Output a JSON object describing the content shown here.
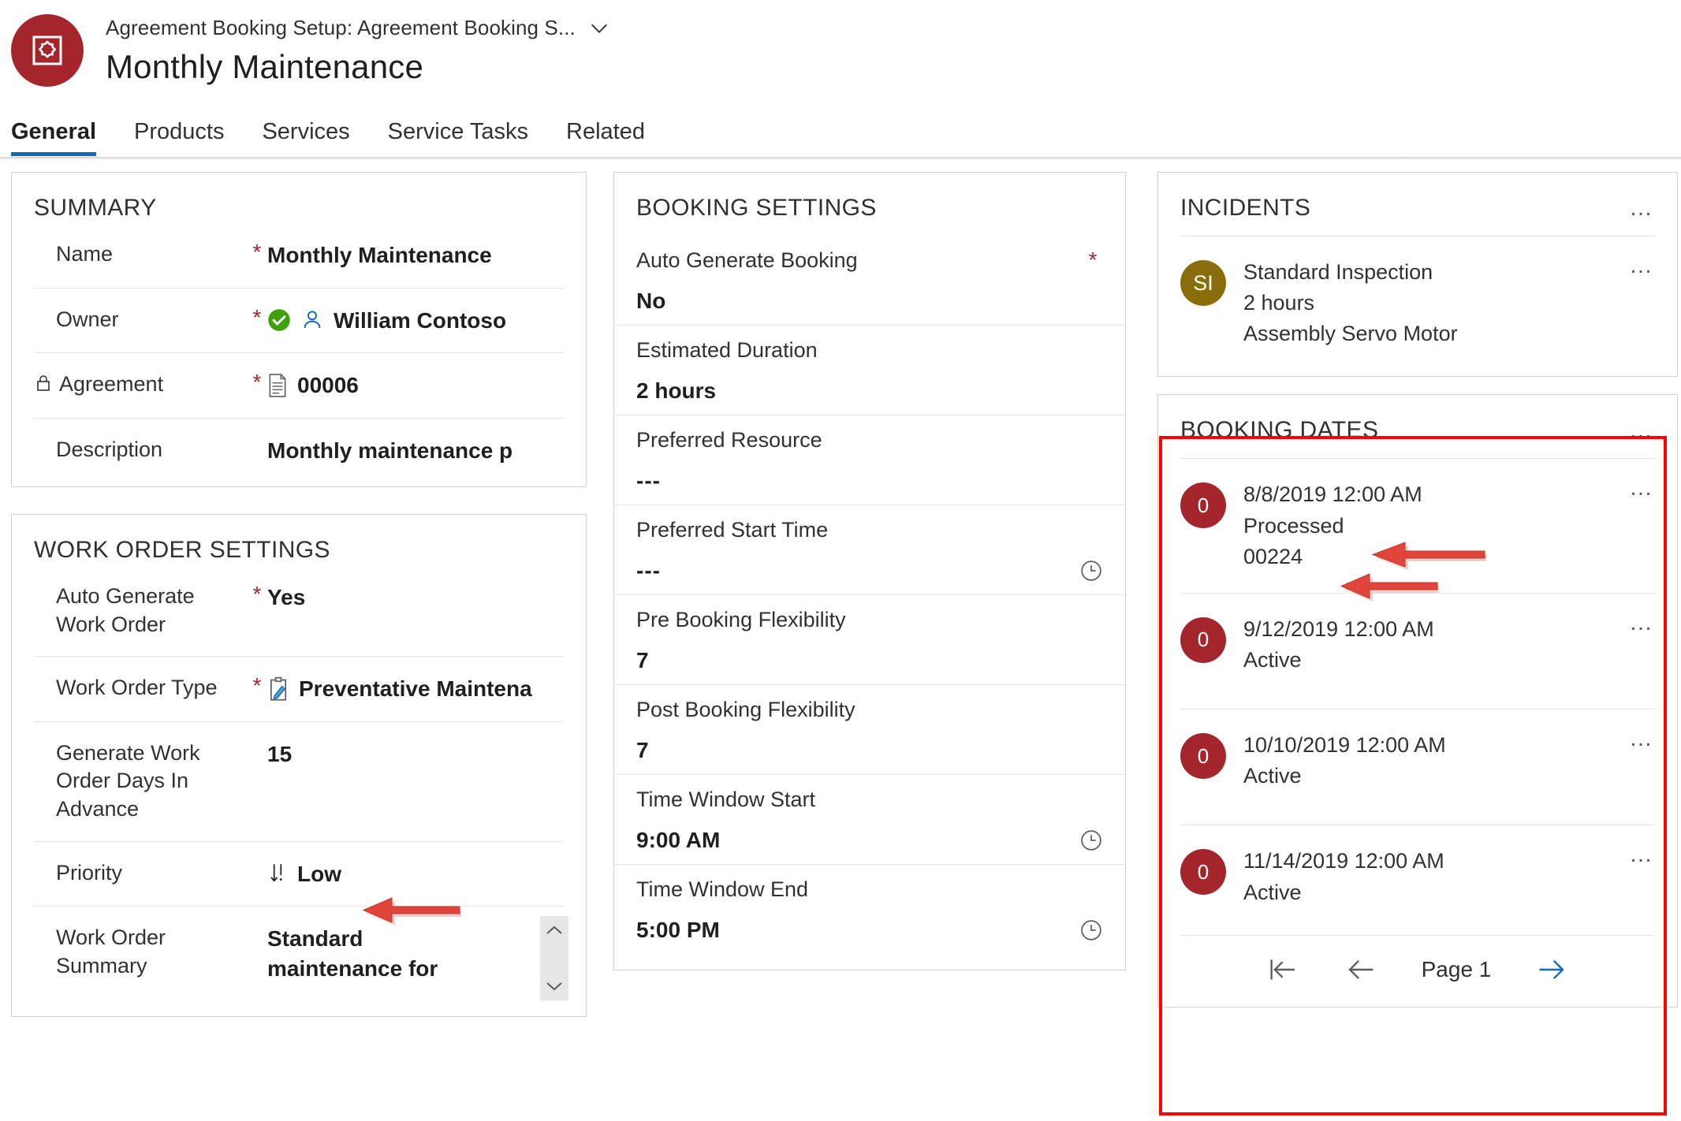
{
  "header": {
    "breadcrumb": "Agreement Booking Setup: Agreement Booking S...",
    "record_title": "Monthly Maintenance",
    "entity_icon": "agreement-booking-setup-icon",
    "avatar_color": "#a4262c"
  },
  "tabs": [
    {
      "label": "General",
      "active": true
    },
    {
      "label": "Products",
      "active": false
    },
    {
      "label": "Services",
      "active": false
    },
    {
      "label": "Service Tasks",
      "active": false
    },
    {
      "label": "Related",
      "active": false
    }
  ],
  "summary": {
    "title": "SUMMARY",
    "fields": [
      {
        "label": "Name",
        "required": true,
        "value": "Monthly Maintenance",
        "locked": false,
        "link": false
      },
      {
        "label": "Owner",
        "required": true,
        "value": "William Contoso",
        "locked": false,
        "link": true,
        "icons": [
          "status-ok-icon",
          "person-icon"
        ]
      },
      {
        "label": "Agreement",
        "required": true,
        "value": "00006",
        "locked": true,
        "link": true,
        "icons": [
          "document-icon"
        ]
      },
      {
        "label": "Description",
        "required": false,
        "value": "Monthly maintenance p",
        "locked": false,
        "link": false
      }
    ]
  },
  "work_order_settings": {
    "title": "WORK ORDER SETTINGS",
    "fields": [
      {
        "label": "Auto Generate Work Order",
        "required": true,
        "value": "Yes",
        "link": false
      },
      {
        "label": "Work Order Type",
        "required": true,
        "value": "Preventative Maintena",
        "link": true,
        "icons": [
          "clipboard-edit-icon"
        ]
      },
      {
        "label": "Generate Work Order Days In Advance",
        "required": false,
        "value": "15",
        "link": false,
        "annotated": true
      },
      {
        "label": "Priority",
        "required": false,
        "value": "Low",
        "link": true,
        "icons": [
          "priority-low-icon"
        ]
      },
      {
        "label": "Work Order Summary",
        "required": false,
        "value": "Standard maintenance for",
        "link": false,
        "scrollable": true
      }
    ]
  },
  "booking_settings": {
    "title": "BOOKING SETTINGS",
    "fields": [
      {
        "label": "Auto Generate Booking",
        "required": true,
        "value": "No",
        "icon": ""
      },
      {
        "label": "Estimated Duration",
        "required": false,
        "value": "2 hours",
        "icon": ""
      },
      {
        "label": "Preferred Resource",
        "required": false,
        "value": "---",
        "icon": ""
      },
      {
        "label": "Preferred Start Time",
        "required": false,
        "value": "---",
        "icon": "clock-icon"
      },
      {
        "label": "Pre Booking Flexibility",
        "required": false,
        "value": "7",
        "icon": ""
      },
      {
        "label": "Post Booking Flexibility",
        "required": false,
        "value": "7",
        "icon": ""
      },
      {
        "label": "Time Window Start",
        "required": false,
        "value": "9:00 AM",
        "icon": "clock-icon"
      },
      {
        "label": "Time Window End",
        "required": false,
        "value": "5:00 PM",
        "icon": "clock-icon"
      }
    ]
  },
  "incidents": {
    "title": "INCIDENTS",
    "menu": "…",
    "items": [
      {
        "initials": "SI",
        "bubble_color": "#8a6d0b",
        "line1": "Standard Inspection",
        "line2": "2 hours",
        "line3": "Assembly Servo Motor"
      }
    ]
  },
  "booking_dates": {
    "title": "BOOKING DATES",
    "menu": "…",
    "highlighted": true,
    "items": [
      {
        "count": "0",
        "bubble_color": "#a4262c",
        "line1": "8/8/2019 12:00 AM",
        "line2": "Processed",
        "line3": "00224",
        "annotated": true
      },
      {
        "count": "0",
        "bubble_color": "#a4262c",
        "line1": "9/12/2019 12:00 AM",
        "line2": "Active",
        "line3": "",
        "annotated": false
      },
      {
        "count": "0",
        "bubble_color": "#a4262c",
        "line1": "10/10/2019 12:00 AM",
        "line2": "Active",
        "line3": "",
        "annotated": false
      },
      {
        "count": "0",
        "bubble_color": "#a4262c",
        "line1": "11/14/2019 12:00 AM",
        "line2": "Active",
        "line3": "",
        "annotated": false
      }
    ],
    "pager": {
      "first_label": "first-page-icon",
      "prev_label": "previous-page-icon",
      "page_label": "Page 1",
      "next_label": "next-page-icon"
    }
  },
  "colors": {
    "brand_red": "#a4262c",
    "link_blue": "#0f6cbd",
    "required_red": "#a4262c",
    "highlight_red": "#ff0000",
    "incident_gold": "#8a6d0b",
    "ok_green": "#3fa20a"
  }
}
